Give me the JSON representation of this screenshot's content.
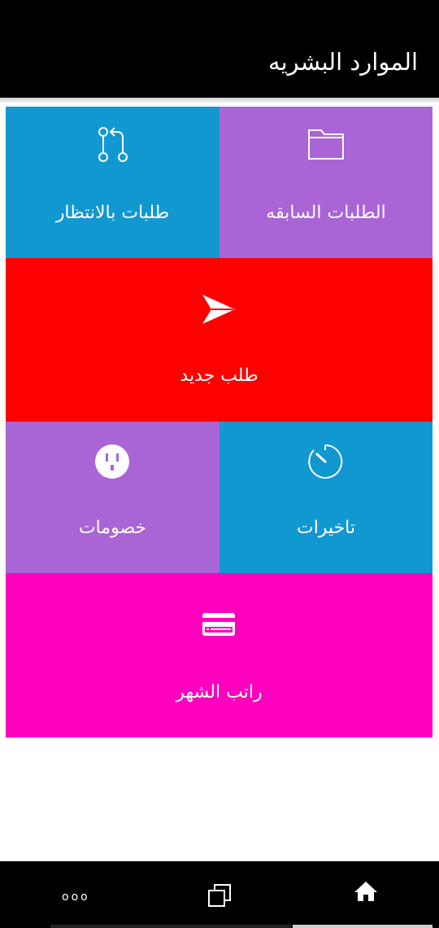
{
  "header": {
    "title": "الموارد البشريه"
  },
  "tiles": {
    "previous_requests": {
      "label": "الطلبات السابقه",
      "icon": "folder-icon",
      "color": "#a964d6"
    },
    "pending_requests": {
      "label": "طلبات بالانتظار",
      "icon": "git-pull-request-icon",
      "color": "#1298d1"
    },
    "new_request": {
      "label": "طلب جديد",
      "icon": "send-icon",
      "color": "#ff0000"
    },
    "delays": {
      "label": "تاخيرات",
      "icon": "timer-icon",
      "color": "#1298d1"
    },
    "deductions": {
      "label": "خصومات",
      "icon": "power-outlet-icon",
      "color": "#a964d6"
    },
    "monthly_salary": {
      "label": "راتب الشهر",
      "icon": "credit-card-icon",
      "color": "#ff00bf"
    }
  },
  "navbar": {
    "items": [
      {
        "icon": "more-dots-icon",
        "label": "ooo"
      },
      {
        "icon": "recent-apps-icon"
      },
      {
        "icon": "home-icon"
      }
    ]
  }
}
